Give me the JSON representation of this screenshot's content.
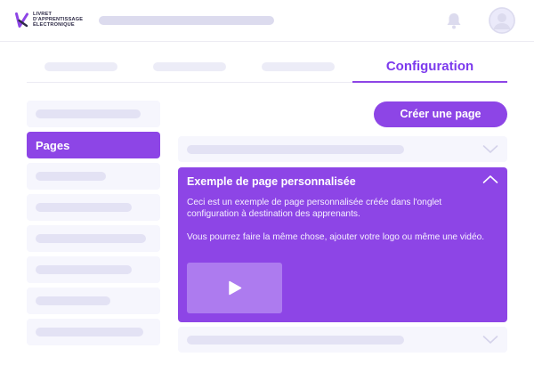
{
  "app": {
    "logo_lines": [
      "LIVRET",
      "D'APPRENTISSAGE",
      "ÉLECTRONIQUE"
    ]
  },
  "header": {
    "icons": [
      "bell-icon",
      "user-avatar-icon"
    ]
  },
  "tabs": {
    "active_label": "Configuration"
  },
  "sidebar": {
    "active_label": "Pages"
  },
  "main": {
    "create_button_label": "Créer une page",
    "expanded_panel": {
      "title": "Exemple de page personnalisée",
      "paragraph1": "Ceci est un exemple de page personnalisée créée dans l'onglet configuration à destination des apprenants.",
      "paragraph2": "Vous pourrez faire la même chose, ajouter votre logo ou même une vidéo.",
      "media_icon": "play-icon"
    }
  },
  "colors": {
    "accent": "#8d45e6",
    "accent_text": "#7c3aed",
    "placeholder": "#e3e2f4",
    "panel_bg": "#f6f6fd"
  }
}
